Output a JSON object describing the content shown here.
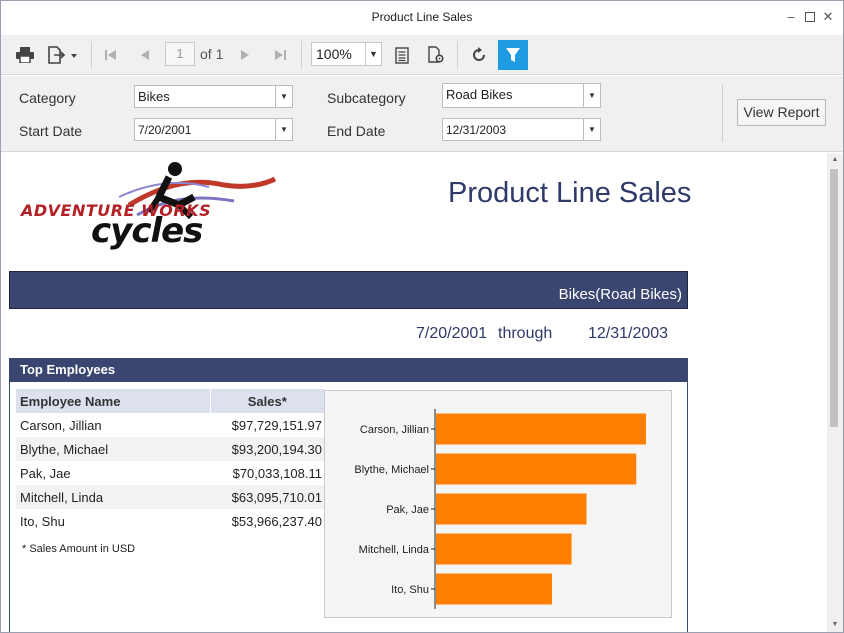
{
  "window": {
    "title": "Product Line Sales"
  },
  "toolbar": {
    "page_number": "1",
    "page_of": "of 1",
    "zoom": "100%"
  },
  "params": {
    "category_label": "Category",
    "category_value": "Bikes",
    "subcategory_label": "Subcategory",
    "subcategory_value": "Road Bikes",
    "start_label": "Start Date",
    "start_value": "7/20/2001",
    "end_label": "End Date",
    "end_value": "12/31/2003",
    "view_report": "View Report"
  },
  "report": {
    "logo_text_top": "ADVENTURE WORKS",
    "logo_text_bottom": "cycles",
    "title": "Product Line Sales",
    "band": "Bikes(Road Bikes)",
    "date_from": "7/20/2001",
    "through": "through",
    "date_to": "12/31/2003",
    "section_title": "Top Employees",
    "col_name": "Employee Name",
    "col_sales": "Sales*",
    "rows": [
      {
        "name": "Carson, Jillian",
        "sales": "$97,729,151.97"
      },
      {
        "name": "Blythe, Michael",
        "sales": "$93,200,194.30"
      },
      {
        "name": "Pak, Jae",
        "sales": "$70,033,108.11"
      },
      {
        "name": "Mitchell, Linda",
        "sales": "$63,095,710.01"
      },
      {
        "name": "Ito, Shu",
        "sales": "$53,966,237.40"
      }
    ],
    "footnote": "* Sales Amount in USD"
  },
  "colors": {
    "accent": "#1e9be1",
    "band": "#3b4670",
    "bar": "#ff8000"
  },
  "chart_data": {
    "type": "bar",
    "orientation": "horizontal",
    "categories": [
      "Carson, Jillian",
      "Blythe, Michael",
      "Pak, Jae",
      "Mitchell, Linda",
      "Ito, Shu"
    ],
    "values": [
      97729151.97,
      93200194.3,
      70033108.11,
      63095710.01,
      53966237.4
    ],
    "title": "",
    "xlabel": "",
    "ylabel": ""
  }
}
